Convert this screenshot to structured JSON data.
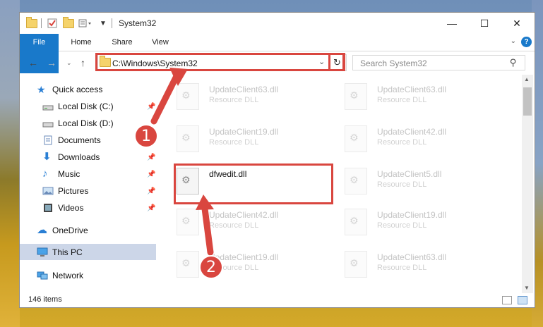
{
  "window": {
    "title": "System32",
    "minimize": "—",
    "maximize": "☐",
    "close": "✕"
  },
  "ribbon": {
    "tabs": [
      "File",
      "Home",
      "Share",
      "View"
    ],
    "help": "?"
  },
  "address": {
    "path": "C:\\Windows\\System32",
    "search_placeholder": "Search System32"
  },
  "nav": {
    "items": [
      {
        "label": "Quick access",
        "icon": "star-icon"
      },
      {
        "label": "Local Disk (C:)",
        "icon": "drive-icon",
        "pinned": true
      },
      {
        "label": "Local Disk (D:)",
        "icon": "drive-icon"
      },
      {
        "label": "Documents",
        "icon": "documents-icon",
        "pinned": true
      },
      {
        "label": "Downloads",
        "icon": "download-icon",
        "pinned": true
      },
      {
        "label": "Music",
        "icon": "music-icon",
        "pinned": true
      },
      {
        "label": "Pictures",
        "icon": "pictures-icon",
        "pinned": true
      },
      {
        "label": "Videos",
        "icon": "videos-icon",
        "pinned": true
      },
      {
        "label": "OneDrive",
        "icon": "cloud-icon"
      },
      {
        "label": "This PC",
        "icon": "computer-icon"
      },
      {
        "label": "Network",
        "icon": "network-icon"
      }
    ]
  },
  "files": [
    {
      "name": "UpdateClient63.dll",
      "desc": "Resource DLL"
    },
    {
      "name": "UpdateClient63.dll",
      "desc": "Resource DLL"
    },
    {
      "name": "UpdateClient19.dll",
      "desc": "Resource DLL"
    },
    {
      "name": "UpdateClient42.dll",
      "desc": "Resource DLL"
    },
    {
      "name": "dfwedit.dll",
      "desc": ""
    },
    {
      "name": "UpdateClient5.dll",
      "desc": "Resource DLL"
    },
    {
      "name": "UpdateClient42.dll",
      "desc": "Resource DLL"
    },
    {
      "name": "UpdateClient19.dll",
      "desc": "Resource DLL"
    },
    {
      "name": "UpdateClient19.dll",
      "desc": "Resource DLL"
    },
    {
      "name": "UpdateClient63.dll",
      "desc": "Resource DLL"
    }
  ],
  "status": {
    "count": "146 items"
  },
  "annotations": {
    "step1": "1",
    "step2": "2",
    "color": "#d9463f"
  }
}
